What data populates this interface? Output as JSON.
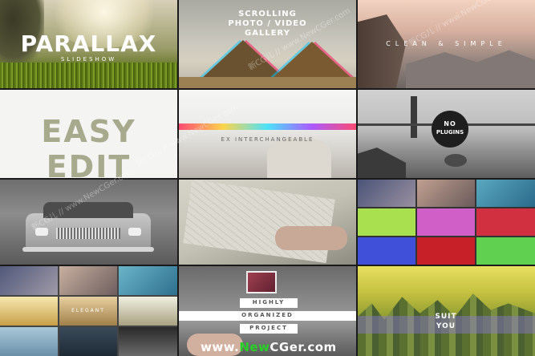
{
  "tiles": {
    "parallax": {
      "title": "PARALLAX",
      "subtitle": "SLIDESHOW"
    },
    "scrolling": {
      "line1": "SCROLLING",
      "line2": "PHOTO / VIDEO",
      "line3": "GALLERY"
    },
    "clean": {
      "text": "CLEAN & SIMPLE"
    },
    "easy": {
      "title": "EASY EDIT"
    },
    "interchangeable": {
      "text": "EX INTERCHANGEABLE"
    },
    "plugins": {
      "line1": "NO",
      "line2": "PLUGINS"
    },
    "elegant": {
      "text": "ELEGANT"
    },
    "organized": {
      "line1": "HIGHLY",
      "line2": "ORGANIZED",
      "line3": "PROJECT"
    },
    "suit": {
      "line1": "SUIT",
      "line2": "YOU"
    }
  },
  "watermark": {
    "text": "www.NewCGer.com",
    "diag": "新CG儿 // www.NewCGer.com"
  }
}
